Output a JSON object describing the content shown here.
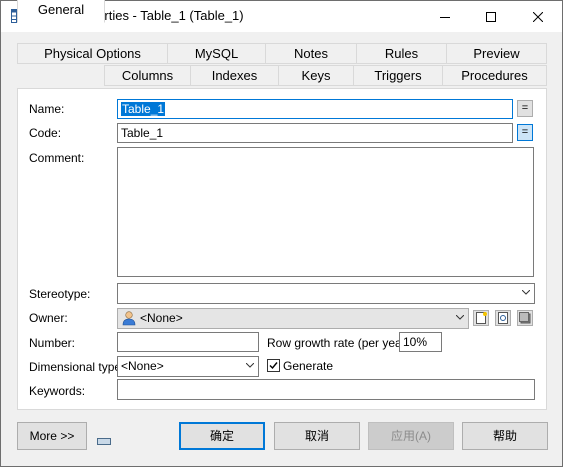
{
  "window": {
    "title": "Table Properties - Table_1 (Table_1)"
  },
  "tabs": {
    "back": [
      "Physical Options",
      "MySQL",
      "Notes",
      "Rules",
      "Preview"
    ],
    "front": [
      "General",
      "Columns",
      "Indexes",
      "Keys",
      "Triggers",
      "Procedures"
    ],
    "active": "General"
  },
  "form": {
    "name_label": "Name:",
    "name_value": "Table_1",
    "code_label": "Code:",
    "code_value": "Table_1",
    "comment_label": "Comment:",
    "comment_value": "",
    "stereotype_label": "Stereotype:",
    "stereotype_value": "",
    "owner_label": "Owner:",
    "owner_value": "<None>",
    "number_label": "Number:",
    "number_value": "",
    "row_growth_label": "Row growth rate (per year):",
    "row_growth_value": "10%",
    "dimensional_label": "Dimensional type:",
    "dimensional_value": "<None>",
    "generate_label": "Generate",
    "generate_checked": true,
    "keywords_label": "Keywords:",
    "keywords_value": "",
    "eq_symbol": "="
  },
  "buttons": {
    "more": "More >>",
    "ok": "确定",
    "cancel": "取消",
    "apply": "应用(A)",
    "help": "帮助"
  },
  "colors": {
    "accent": "#0078d7",
    "window_bg": "#f0f0f0"
  }
}
